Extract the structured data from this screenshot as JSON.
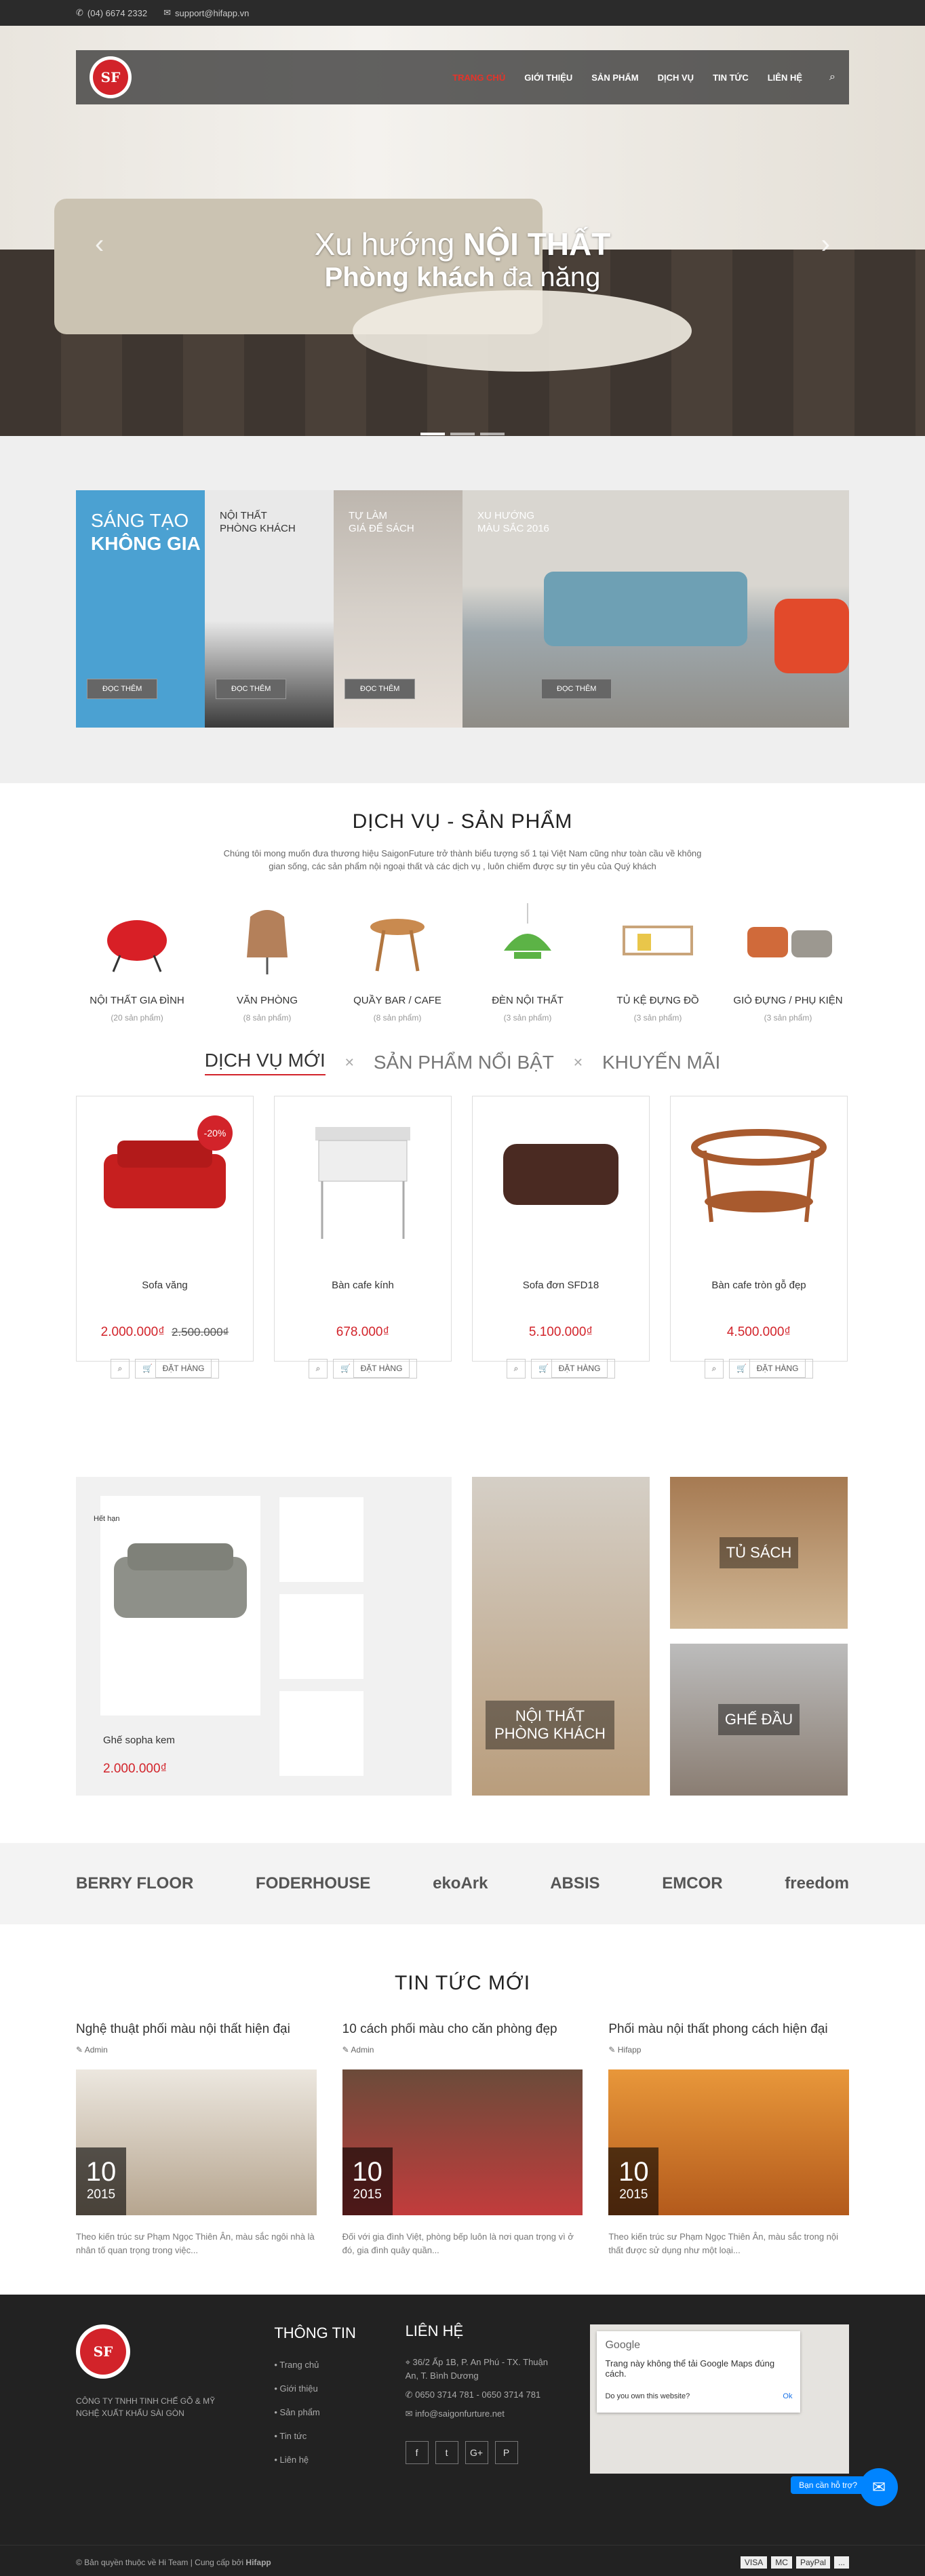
{
  "topbar": {
    "phone": "(04) 6674 2332",
    "email": "support@hifapp.vn"
  },
  "nav": {
    "logo": "SF",
    "items": [
      "TRANG CHỦ",
      "GIỚI THIỆU",
      "SẢN PHẨM",
      "DỊCH VỤ",
      "TIN TỨC",
      "LIÊN HỆ"
    ]
  },
  "hero": {
    "line1_light": "Xu hướng",
    "line1_bold": "NỘI THẤT",
    "line2_bold": "Phòng khách",
    "line2_light": "đa năng"
  },
  "promo": [
    {
      "title1": "SÁNG TẠO",
      "title2": "KHÔNG GIA",
      "button": "ĐỌC THÊM",
      "color": "#4ba1d2"
    },
    {
      "title1": "NỘI THẤT",
      "title2": "PHÒNG KHÁCH",
      "button": "ĐỌC THÊM",
      "color": "#d8d8d8"
    },
    {
      "title1": "TỰ LÀM",
      "title2": "GIÁ ĐỂ SÁCH",
      "button": "ĐỌC THÊM",
      "color": "#c9c3bd"
    },
    {
      "title1": "XU HƯỚNG",
      "title2": "MÀU SẮC 2016",
      "button": "ĐỌC THÊM",
      "color": "#bdbbb6"
    }
  ],
  "services": {
    "title": "DỊCH VỤ - SẢN PHẨM",
    "desc": "Chúng tôi mong muốn đưa thương hiệu SaigonFuture trở thành biểu tượng số 1 tại Việt Nam cũng như toàn cầu về không gian sống, các sản phẩm nội ngoại thất và các dịch vụ , luôn chiếm được sự tin yêu của Quý khách",
    "categories": [
      {
        "name": "NỘI THẤT GIA ĐÌNH",
        "count": "(20 sản phẩm)"
      },
      {
        "name": "VĂN PHÒNG",
        "count": "(8 sản phẩm)"
      },
      {
        "name": "QUẦY BAR / CAFE",
        "count": "(8 sản phẩm)"
      },
      {
        "name": "ĐÈN NỘI THẤT",
        "count": "(3 sản phẩm)"
      },
      {
        "name": "TỦ KỆ ĐỰNG ĐỒ",
        "count": "(3 sản phẩm)"
      },
      {
        "name": "GIỎ ĐỰNG / PHỤ KIỆN",
        "count": "(3 sản phẩm)"
      }
    ]
  },
  "tabs": [
    "DỊCH VỤ MỚI",
    "SẢN PHẨM NỔI BẬT",
    "KHUYẾN MÃI"
  ],
  "products": [
    {
      "name": "Sofa văng",
      "price": "2.000.000₫",
      "old": "2.500.000₫",
      "badge": "-20%"
    },
    {
      "name": "Bàn cafe kính",
      "price": "678.000₫",
      "old": "",
      "badge": ""
    },
    {
      "name": "Sofa đơn SFD18",
      "price": "5.100.000₫",
      "old": "",
      "badge": ""
    },
    {
      "name": "Bàn cafe tròn gỗ đẹp",
      "price": "4.500.000₫",
      "old": "",
      "badge": ""
    }
  ],
  "product_actions": {
    "cart": "ĐẶT HÀNG"
  },
  "featured": {
    "label": "Hết hạn",
    "name": "Ghế sopha kem",
    "price": "2.000.000₫",
    "tile1": "NỘI THẤT PHÒNG KHÁCH",
    "tile2": "TỦ SÁCH",
    "tile3": "GHẾ ĐẦU"
  },
  "brands": [
    "BERRY FLOOR",
    "FODERHOUSE",
    "ekoArk",
    "ABSIS",
    "EMCOR",
    "freedom"
  ],
  "news": {
    "title": "TIN TỨC MỚI",
    "items": [
      {
        "title": "Nghệ thuật phối màu nội thất hiện đại",
        "author": "Admin",
        "day": "10",
        "year": "2015",
        "desc": "Theo kiến trúc sư Phạm Ngọc Thiên Ân, màu sắc ngôi nhà là nhân tố quan trọng trong việc..."
      },
      {
        "title": "10 cách phối màu cho căn phòng đẹp",
        "author": "Admin",
        "day": "10",
        "year": "2015",
        "desc": "Đối với gia đình Việt, phòng bếp luôn là nơi quan trọng vì ở đó, gia đình quây quần..."
      },
      {
        "title": "Phối màu nội thất phong cách hiện đại",
        "author": "Hifapp",
        "day": "10",
        "year": "2015",
        "desc": "Theo kiến trúc sư Phạm Ngọc Thiên Ân, màu sắc trong nội thất được sử dụng như một loại..."
      }
    ]
  },
  "footer": {
    "company": "CÔNG TY TNHH TINH CHẾ GỖ & MỸ NGHỆ XUẤT KHẨU SÀI GÒN",
    "info_title": "THÔNG TIN",
    "info_items": [
      "Trang chủ",
      "Giới thiệu",
      "Sản phẩm",
      "Tin tức",
      "Liên hệ"
    ],
    "contact_title": "LIÊN HỆ",
    "address": "36/2 Ấp 1B, P. An Phú - TX. Thuận An, T. Bình Dương",
    "phone": "0650 3714 781 - 0650 3714 781",
    "email": "info@saigonfurture.net",
    "socials": [
      "f",
      "t",
      "G+",
      "P"
    ],
    "map_brand": "Google",
    "map_msg": "Trang này không thể tải Google Maps đúng cách.",
    "map_q": "Do you own this website?",
    "map_ok": "Ok",
    "copyright_left": "© Bản quyền thuộc về Hi Team | Cung cấp bởi",
    "copyright_brand": "Hifapp",
    "payments": [
      "VISA",
      "MC",
      "PayPal",
      "..."
    ]
  },
  "chat": {
    "label": "Bạn cần hỗ trợ?",
    "count": "1"
  }
}
